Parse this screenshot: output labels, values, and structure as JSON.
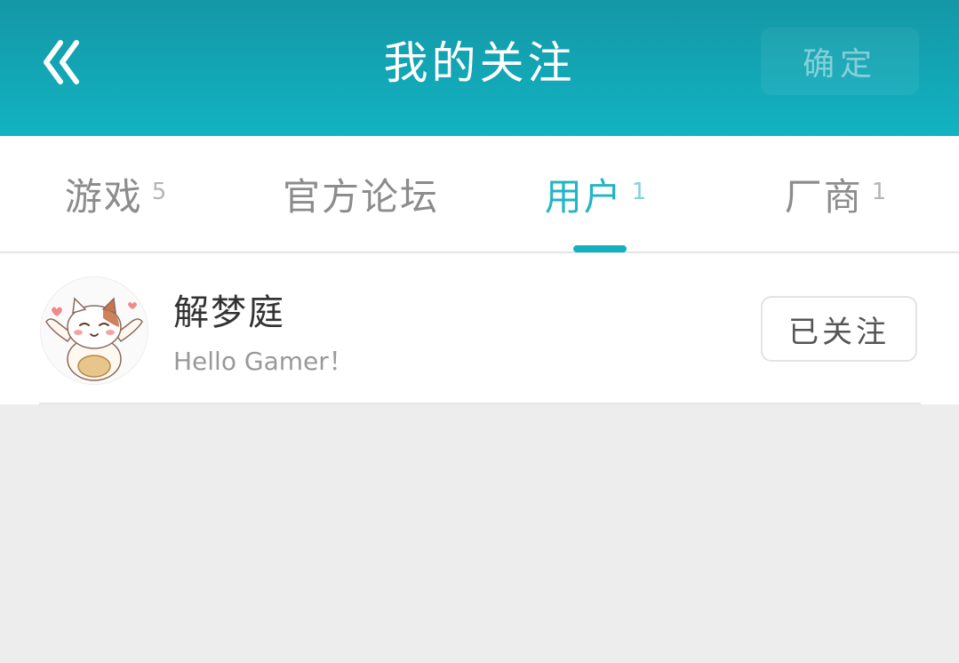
{
  "header": {
    "title": "我的关注",
    "confirm_label": "确定",
    "back_icon": "double-chevron-left-icon",
    "background_colors": [
      "#1497a6",
      "#12b3c2"
    ]
  },
  "tabs": [
    {
      "label": "游戏",
      "count": "5",
      "active": false
    },
    {
      "label": "官方论坛",
      "count": "",
      "active": false
    },
    {
      "label": "用户",
      "count": "1",
      "active": true
    },
    {
      "label": "厂商",
      "count": "1",
      "active": false
    }
  ],
  "accent_color": "#14b0c0",
  "list": [
    {
      "name": "解梦庭",
      "bio": "Hello Gamer！",
      "button_label": "已关注",
      "avatar_icon": "cat-avatar-icon"
    }
  ]
}
